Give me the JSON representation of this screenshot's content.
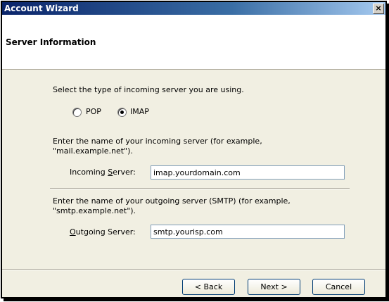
{
  "window": {
    "title": "Account Wizard",
    "close_glyph": "×",
    "header_title": "Server Information"
  },
  "server_type": {
    "prompt": "Select the type of incoming server you are using.",
    "options": [
      {
        "label": "POP",
        "selected": false
      },
      {
        "label": "IMAP",
        "selected": true
      }
    ]
  },
  "incoming": {
    "instruction_line1": "Enter the name of your incoming server (for example,",
    "instruction_line2": "\"mail.example.net\").",
    "label_pre": "Incoming ",
    "label_mnemonic": "S",
    "label_post": "erver:",
    "value": "imap.yourdomain.com"
  },
  "outgoing": {
    "instruction_line1": "Enter the name of your outgoing server (SMTP) (for example,",
    "instruction_line2": "\"smtp.example.net\").",
    "label_mnemonic": "O",
    "label_post": "utgoing Server:",
    "value": "smtp.yourisp.com"
  },
  "buttons": {
    "back": "< Back",
    "next": "Next >",
    "cancel": "Cancel"
  }
}
